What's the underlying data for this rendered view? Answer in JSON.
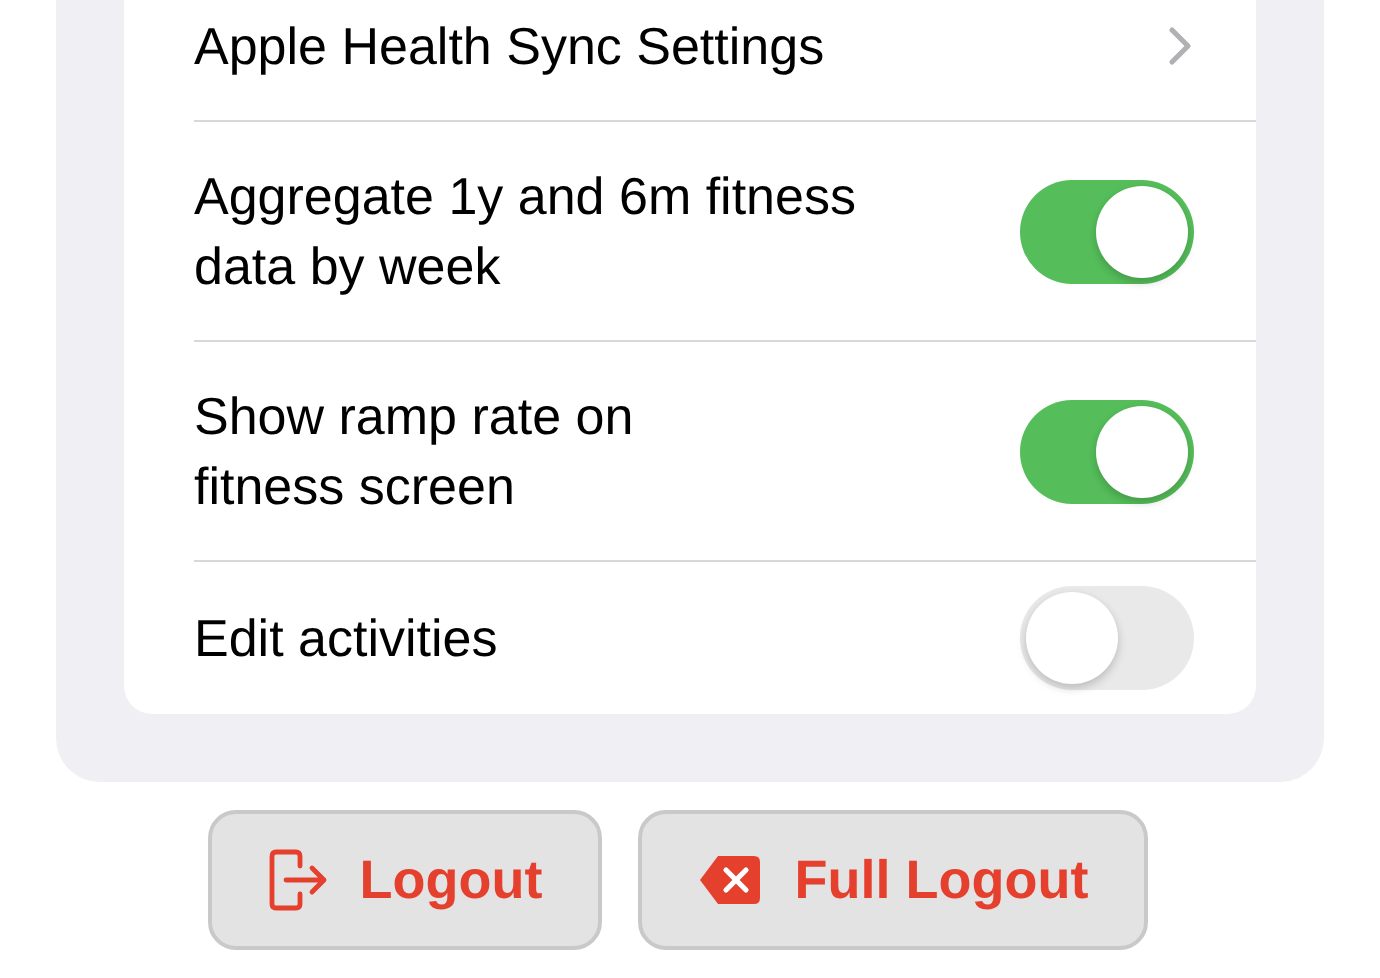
{
  "settings": [
    {
      "kind": "link",
      "lines": [
        "Apple Health Sync Settings"
      ]
    },
    {
      "kind": "toggle",
      "lines": [
        "Aggregate 1y and 6m fitness",
        "data by week"
      ],
      "on": true
    },
    {
      "kind": "toggle",
      "lines": [
        "Show ramp rate on",
        "fitness screen"
      ],
      "on": true
    },
    {
      "kind": "toggle",
      "lines": [
        "Edit activities"
      ],
      "on": false
    }
  ],
  "buttons": [
    {
      "kind": "logout",
      "label": "Logout"
    },
    {
      "kind": "full-logout",
      "label": "Full Logout"
    }
  ]
}
